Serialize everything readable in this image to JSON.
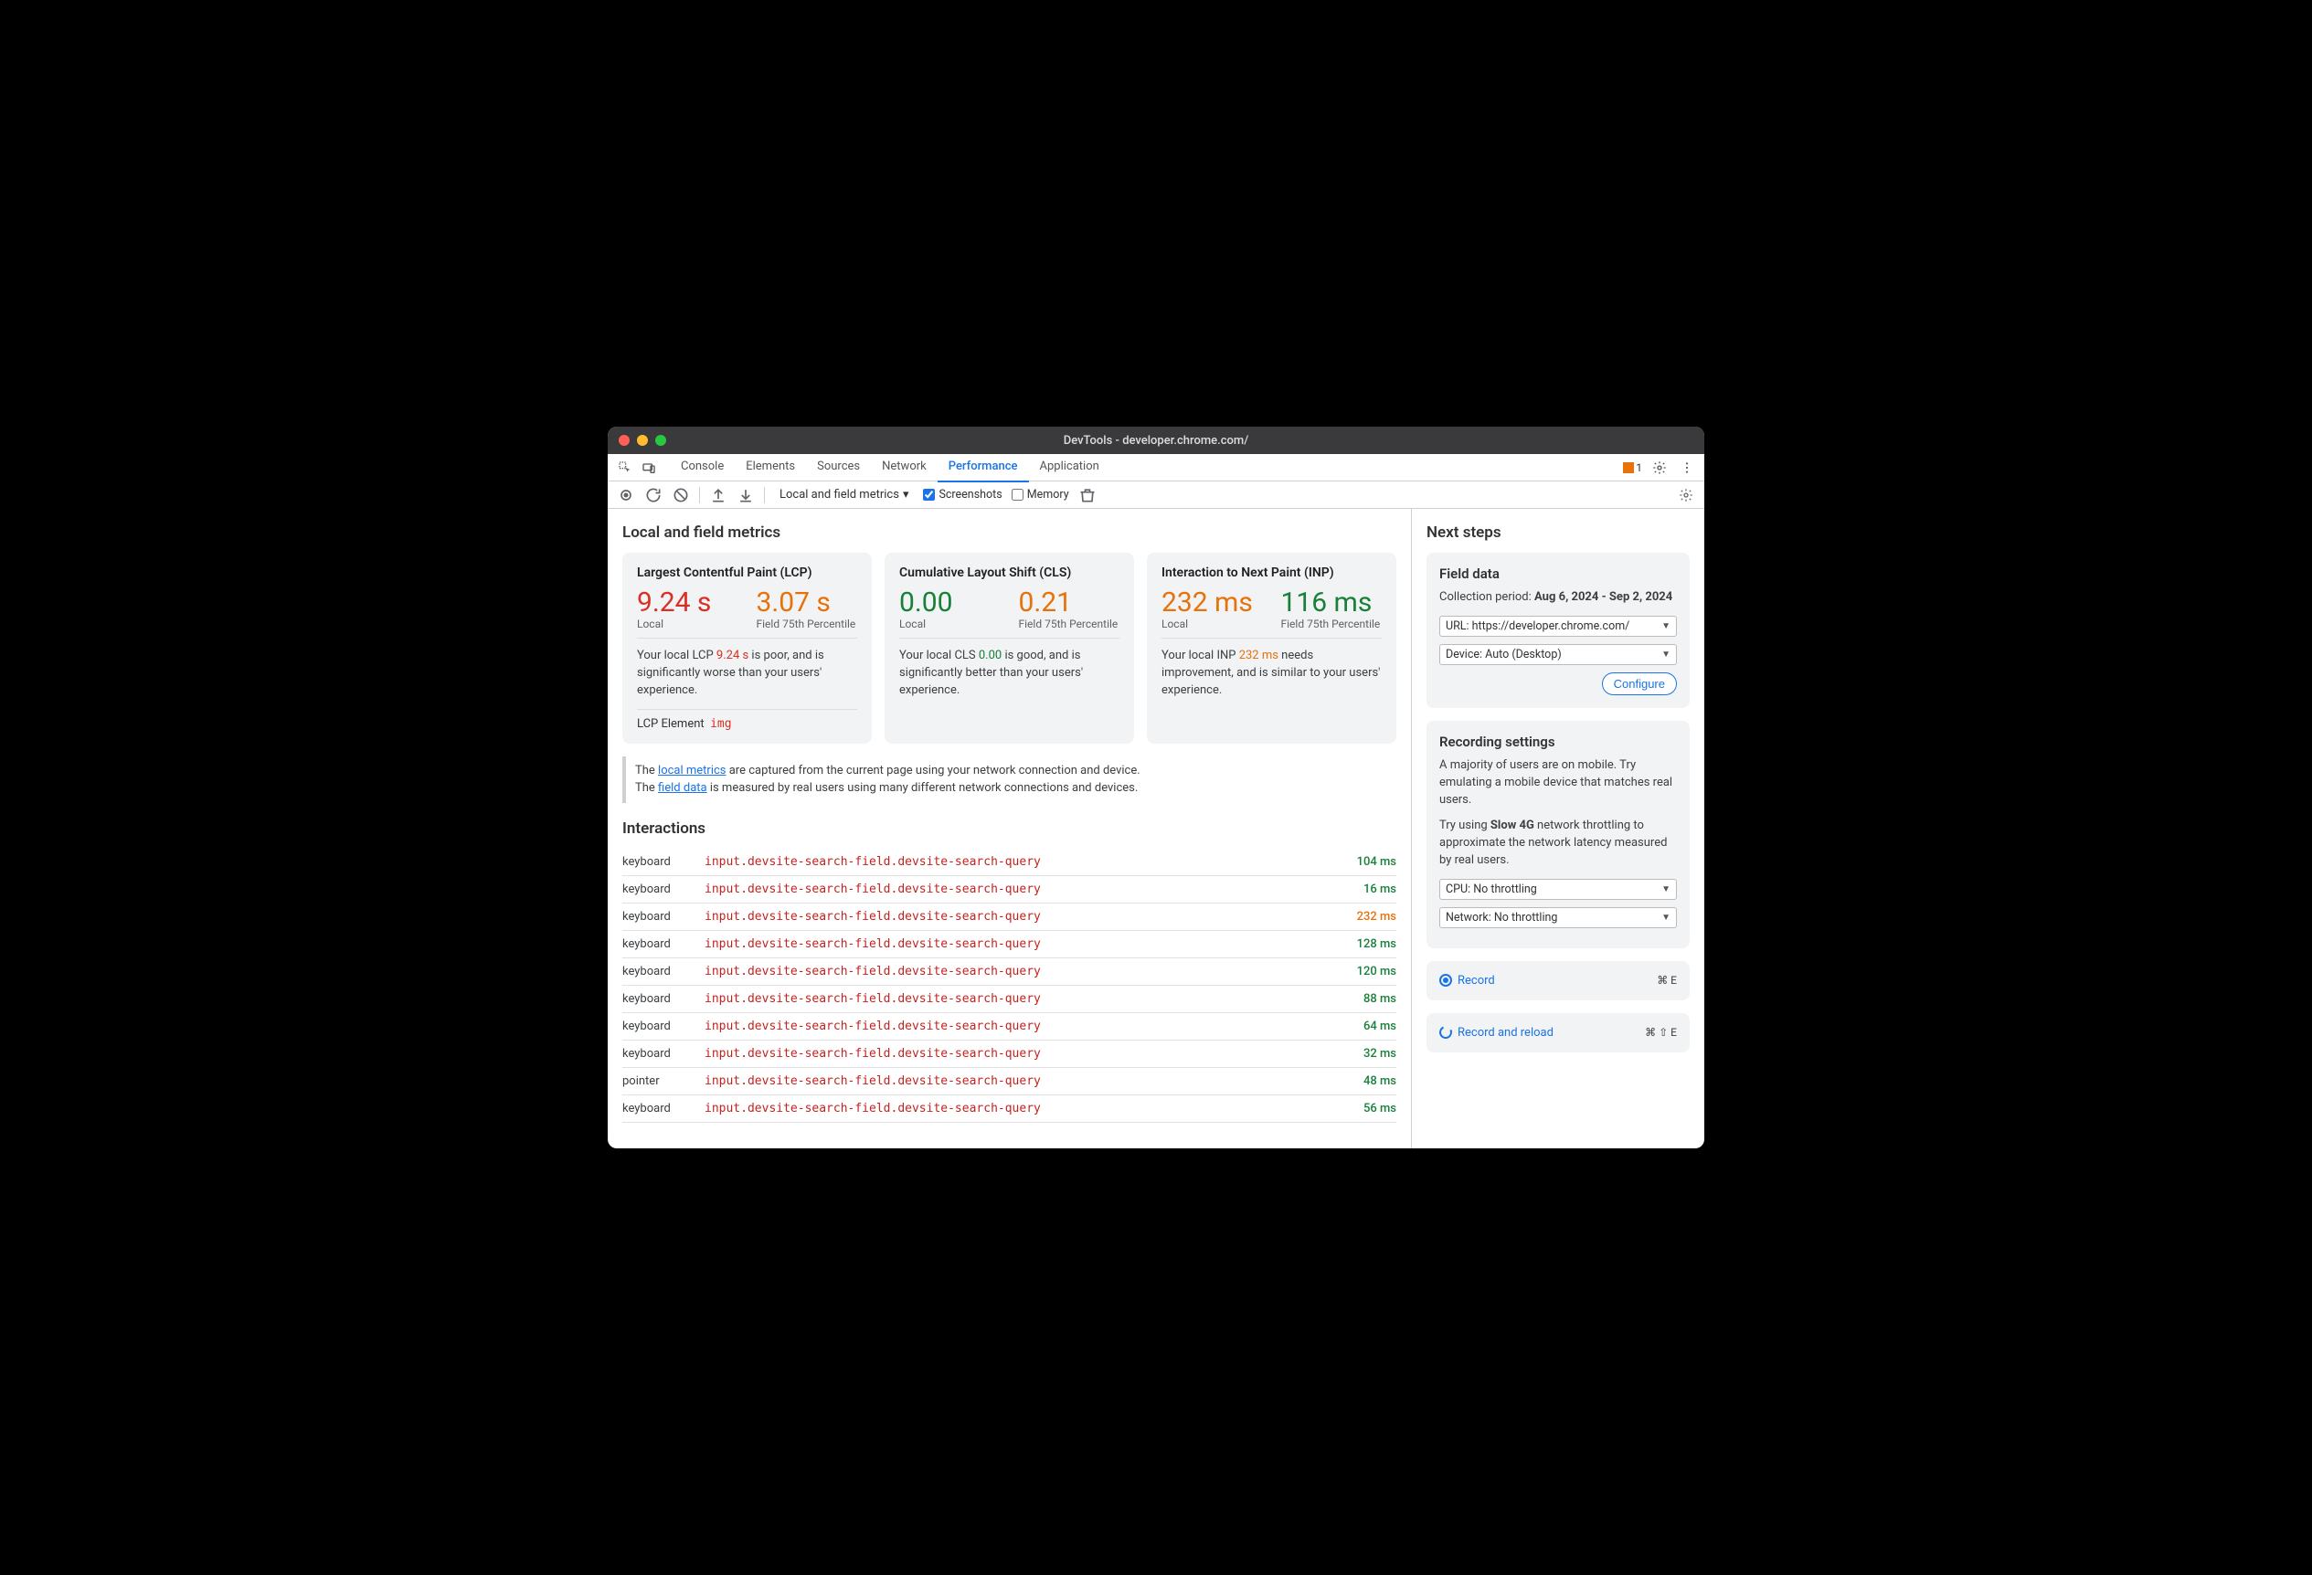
{
  "window": {
    "title": "DevTools - developer.chrome.com/"
  },
  "tabs": [
    "Console",
    "Elements",
    "Sources",
    "Network",
    "Performance",
    "Application"
  ],
  "tabs_active_index": 4,
  "issues_count": "1",
  "toolbar": {
    "dropdown": "Local and field metrics",
    "screenshots_label": "Screenshots",
    "memory_label": "Memory"
  },
  "main": {
    "heading": "Local and field metrics",
    "cards": [
      {
        "title": "Largest Contentful Paint (LCP)",
        "local_value": "9.24 s",
        "local_class": "red",
        "field_value": "3.07 s",
        "field_class": "orange",
        "local_label": "Local",
        "field_label": "Field 75th Percentile",
        "desc_pre": "Your local LCP ",
        "desc_val": "9.24 s",
        "desc_val_class": "red",
        "desc_post": " is poor, and is significantly worse than your users' experience.",
        "foot_label": "LCP Element",
        "foot_value": "img"
      },
      {
        "title": "Cumulative Layout Shift (CLS)",
        "local_value": "0.00",
        "local_class": "green",
        "field_value": "0.21",
        "field_class": "orange",
        "local_label": "Local",
        "field_label": "Field 75th Percentile",
        "desc_pre": "Your local CLS ",
        "desc_val": "0.00",
        "desc_val_class": "green",
        "desc_post": " is good, and is significantly better than your users' experience."
      },
      {
        "title": "Interaction to Next Paint (INP)",
        "local_value": "232 ms",
        "local_class": "orange",
        "field_value": "116 ms",
        "field_class": "green",
        "local_label": "Local",
        "field_label": "Field 75th Percentile",
        "desc_pre": "Your local INP ",
        "desc_val": "232 ms",
        "desc_val_class": "orange",
        "desc_post": " needs improvement, and is similar to your users' experience."
      }
    ],
    "note_pre1": "The ",
    "note_link1": "local metrics",
    "note_post1": " are captured from the current page using your network connection and device.",
    "note_pre2": "The ",
    "note_link2": "field data",
    "note_post2": " is measured by real users using many different network connections and devices.",
    "interactions_heading": "Interactions",
    "interactions": [
      {
        "type": "keyboard",
        "selector": "input.devsite-search-field.devsite-search-query",
        "ms": "104 ms",
        "ms_class": "green"
      },
      {
        "type": "keyboard",
        "selector": "input.devsite-search-field.devsite-search-query",
        "ms": "16 ms",
        "ms_class": "green"
      },
      {
        "type": "keyboard",
        "selector": "input.devsite-search-field.devsite-search-query",
        "ms": "232 ms",
        "ms_class": "orange"
      },
      {
        "type": "keyboard",
        "selector": "input.devsite-search-field.devsite-search-query",
        "ms": "128 ms",
        "ms_class": "green"
      },
      {
        "type": "keyboard",
        "selector": "input.devsite-search-field.devsite-search-query",
        "ms": "120 ms",
        "ms_class": "green"
      },
      {
        "type": "keyboard",
        "selector": "input.devsite-search-field.devsite-search-query",
        "ms": "88 ms",
        "ms_class": "green"
      },
      {
        "type": "keyboard",
        "selector": "input.devsite-search-field.devsite-search-query",
        "ms": "64 ms",
        "ms_class": "green"
      },
      {
        "type": "keyboard",
        "selector": "input.devsite-search-field.devsite-search-query",
        "ms": "32 ms",
        "ms_class": "green"
      },
      {
        "type": "pointer",
        "selector": "input.devsite-search-field.devsite-search-query",
        "ms": "48 ms",
        "ms_class": "green"
      },
      {
        "type": "keyboard",
        "selector": "input.devsite-search-field.devsite-search-query",
        "ms": "56 ms",
        "ms_class": "green"
      }
    ]
  },
  "side": {
    "heading": "Next steps",
    "field": {
      "title": "Field data",
      "period_label": "Collection period: ",
      "period_value": "Aug 6, 2024 - Sep 2, 2024",
      "url_select": "URL: https://developer.chrome.com/",
      "device_select": "Device: Auto (Desktop)",
      "configure": "Configure"
    },
    "rec": {
      "title": "Recording settings",
      "p1": "A majority of users are on mobile. Try emulating a mobile device that matches real users.",
      "p2_pre": "Try using ",
      "p2_bold": "Slow 4G",
      "p2_post": " network throttling to approximate the network latency measured by real users.",
      "cpu_select": "CPU: No throttling",
      "net_select": "Network: No throttling"
    },
    "record": {
      "label": "Record",
      "shortcut": "⌘ E"
    },
    "record_reload": {
      "label": "Record and reload",
      "shortcut": "⌘ ⇧ E"
    }
  }
}
